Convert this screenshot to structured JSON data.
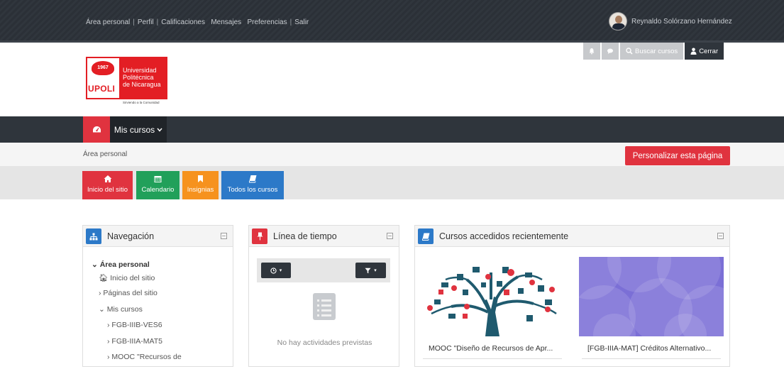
{
  "topbar": {
    "links": [
      "Área personal",
      "Perfil",
      "Calificaciones",
      "Mensajes",
      "Preferencias",
      "Salir"
    ],
    "user_name": "Reynaldo Solórzano Hernández"
  },
  "header": {
    "search_label": "Buscar cursos",
    "logout_label": "Cerrar",
    "logo": {
      "year": "1967",
      "short": "UPOLI",
      "line1": "Universidad",
      "line2": "Politécnica",
      "line3": "de Nicaragua",
      "tagline": "Sirviendo a la Comunidad"
    }
  },
  "navbar": {
    "my_courses": "Mis cursos"
  },
  "breadcrumb": {
    "current": "Área personal",
    "customize_button": "Personalizar esta página"
  },
  "tiles": [
    {
      "label": "Inicio del sitio",
      "icon": "home-icon"
    },
    {
      "label": "Calendario",
      "icon": "calendar-icon"
    },
    {
      "label": "Insignias",
      "icon": "bookmark-icon"
    },
    {
      "label": "Todos los cursos",
      "icon": "book-icon"
    }
  ],
  "blocks": {
    "navigation": {
      "title": "Navegación",
      "items": [
        {
          "label": "Área personal"
        },
        {
          "label": "Inicio del sitio"
        },
        {
          "label": "Páginas del sitio"
        },
        {
          "label": "Mis cursos"
        },
        {
          "label": "FGB-IIIB-VES6"
        },
        {
          "label": "FGB-IIIA-MAT5"
        },
        {
          "label": "MOOC \"Recursos de"
        }
      ]
    },
    "timeline": {
      "title": "Línea de tiempo",
      "empty_text": "No hay actividades previstas"
    },
    "recent": {
      "title": "Cursos accedidos recientemente",
      "courses": [
        {
          "name": "MOOC \"Diseño de Recursos de Apr..."
        },
        {
          "name": "[FGB-IIIA-MAT] Créditos Alternativo..."
        }
      ]
    }
  },
  "colors": {
    "accent_red": "#e0333f",
    "green": "#21a05a",
    "orange": "#f6921e",
    "blue": "#2c79c8",
    "dark": "#2f353c"
  }
}
